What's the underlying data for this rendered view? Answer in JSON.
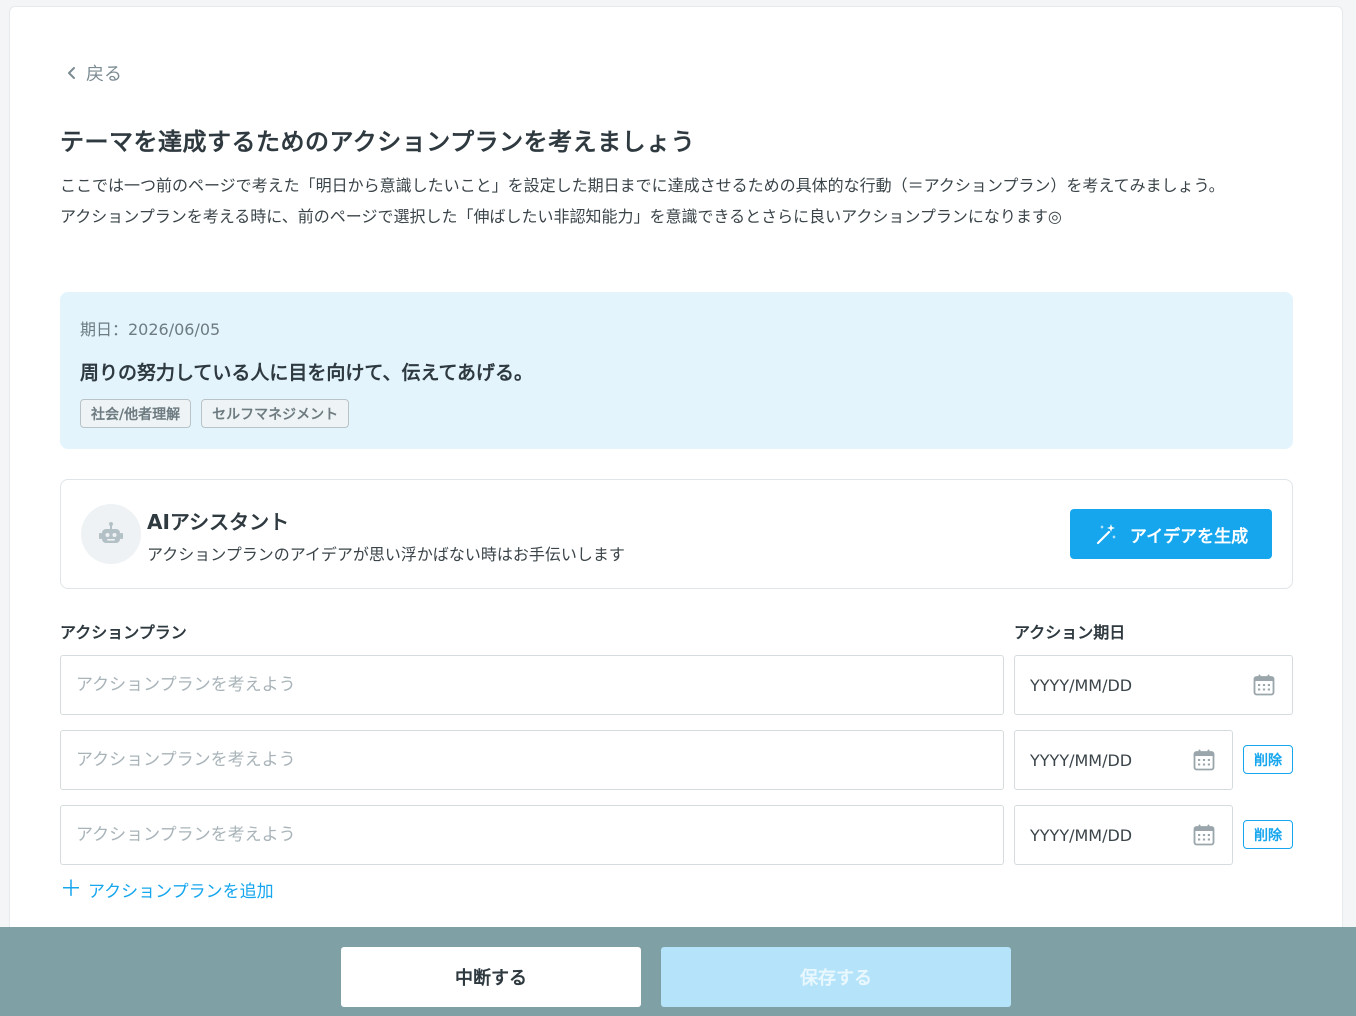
{
  "nav": {
    "back_label": "戻る"
  },
  "page": {
    "title": "テーマを達成するためのアクションプランを考えましょう",
    "description_1": "ここでは一つ前のページで考えた「明日から意識したいこと」を設定した期日までに達成させるための具体的な行動（＝アクションプラン）を考えてみましょう。",
    "description_2": "アクションプランを考える時に、前のページで選択した「伸ばしたい非認知能力」を意識できるとさらに良いアクションプランになります◎"
  },
  "goal": {
    "due_label": "期日：2026/06/05",
    "text": "周りの努力している人に目を向けて、伝えてあげる。",
    "tags": [
      "社会/他者理解",
      "セルフマネジメント"
    ]
  },
  "ai_assistant": {
    "title": "AIアシスタント",
    "subtitle": "アクションプランのアイデアが思い浮かばない時はお手伝いします",
    "button_label": "アイデアを生成",
    "icon": "magic-wand-icon",
    "avatar_icon": "robot-icon"
  },
  "form": {
    "plan_header": "アクションプラン",
    "date_header": "アクション期日",
    "rows": [
      {
        "plan_placeholder": "アクションプランを考えよう",
        "plan_value": "",
        "date_placeholder": "YYYY/MM/DD",
        "deletable": false
      },
      {
        "plan_placeholder": "アクションプランを考えよう",
        "plan_value": "",
        "date_placeholder": "YYYY/MM/DD",
        "deletable": true
      },
      {
        "plan_placeholder": "アクションプランを考えよう",
        "plan_value": "",
        "date_placeholder": "YYYY/MM/DD",
        "deletable": true
      }
    ],
    "delete_label": "削除",
    "add_label": "アクションプランを追加",
    "add_symbol": "＋"
  },
  "footer": {
    "suspend_label": "中断する",
    "save_label": "保存する"
  },
  "colors": {
    "accent": "#16a6ee",
    "goal_background": "#e3f4fc",
    "footer_background": "#7fa1a6",
    "save_disabled": "#b5e4fa"
  }
}
